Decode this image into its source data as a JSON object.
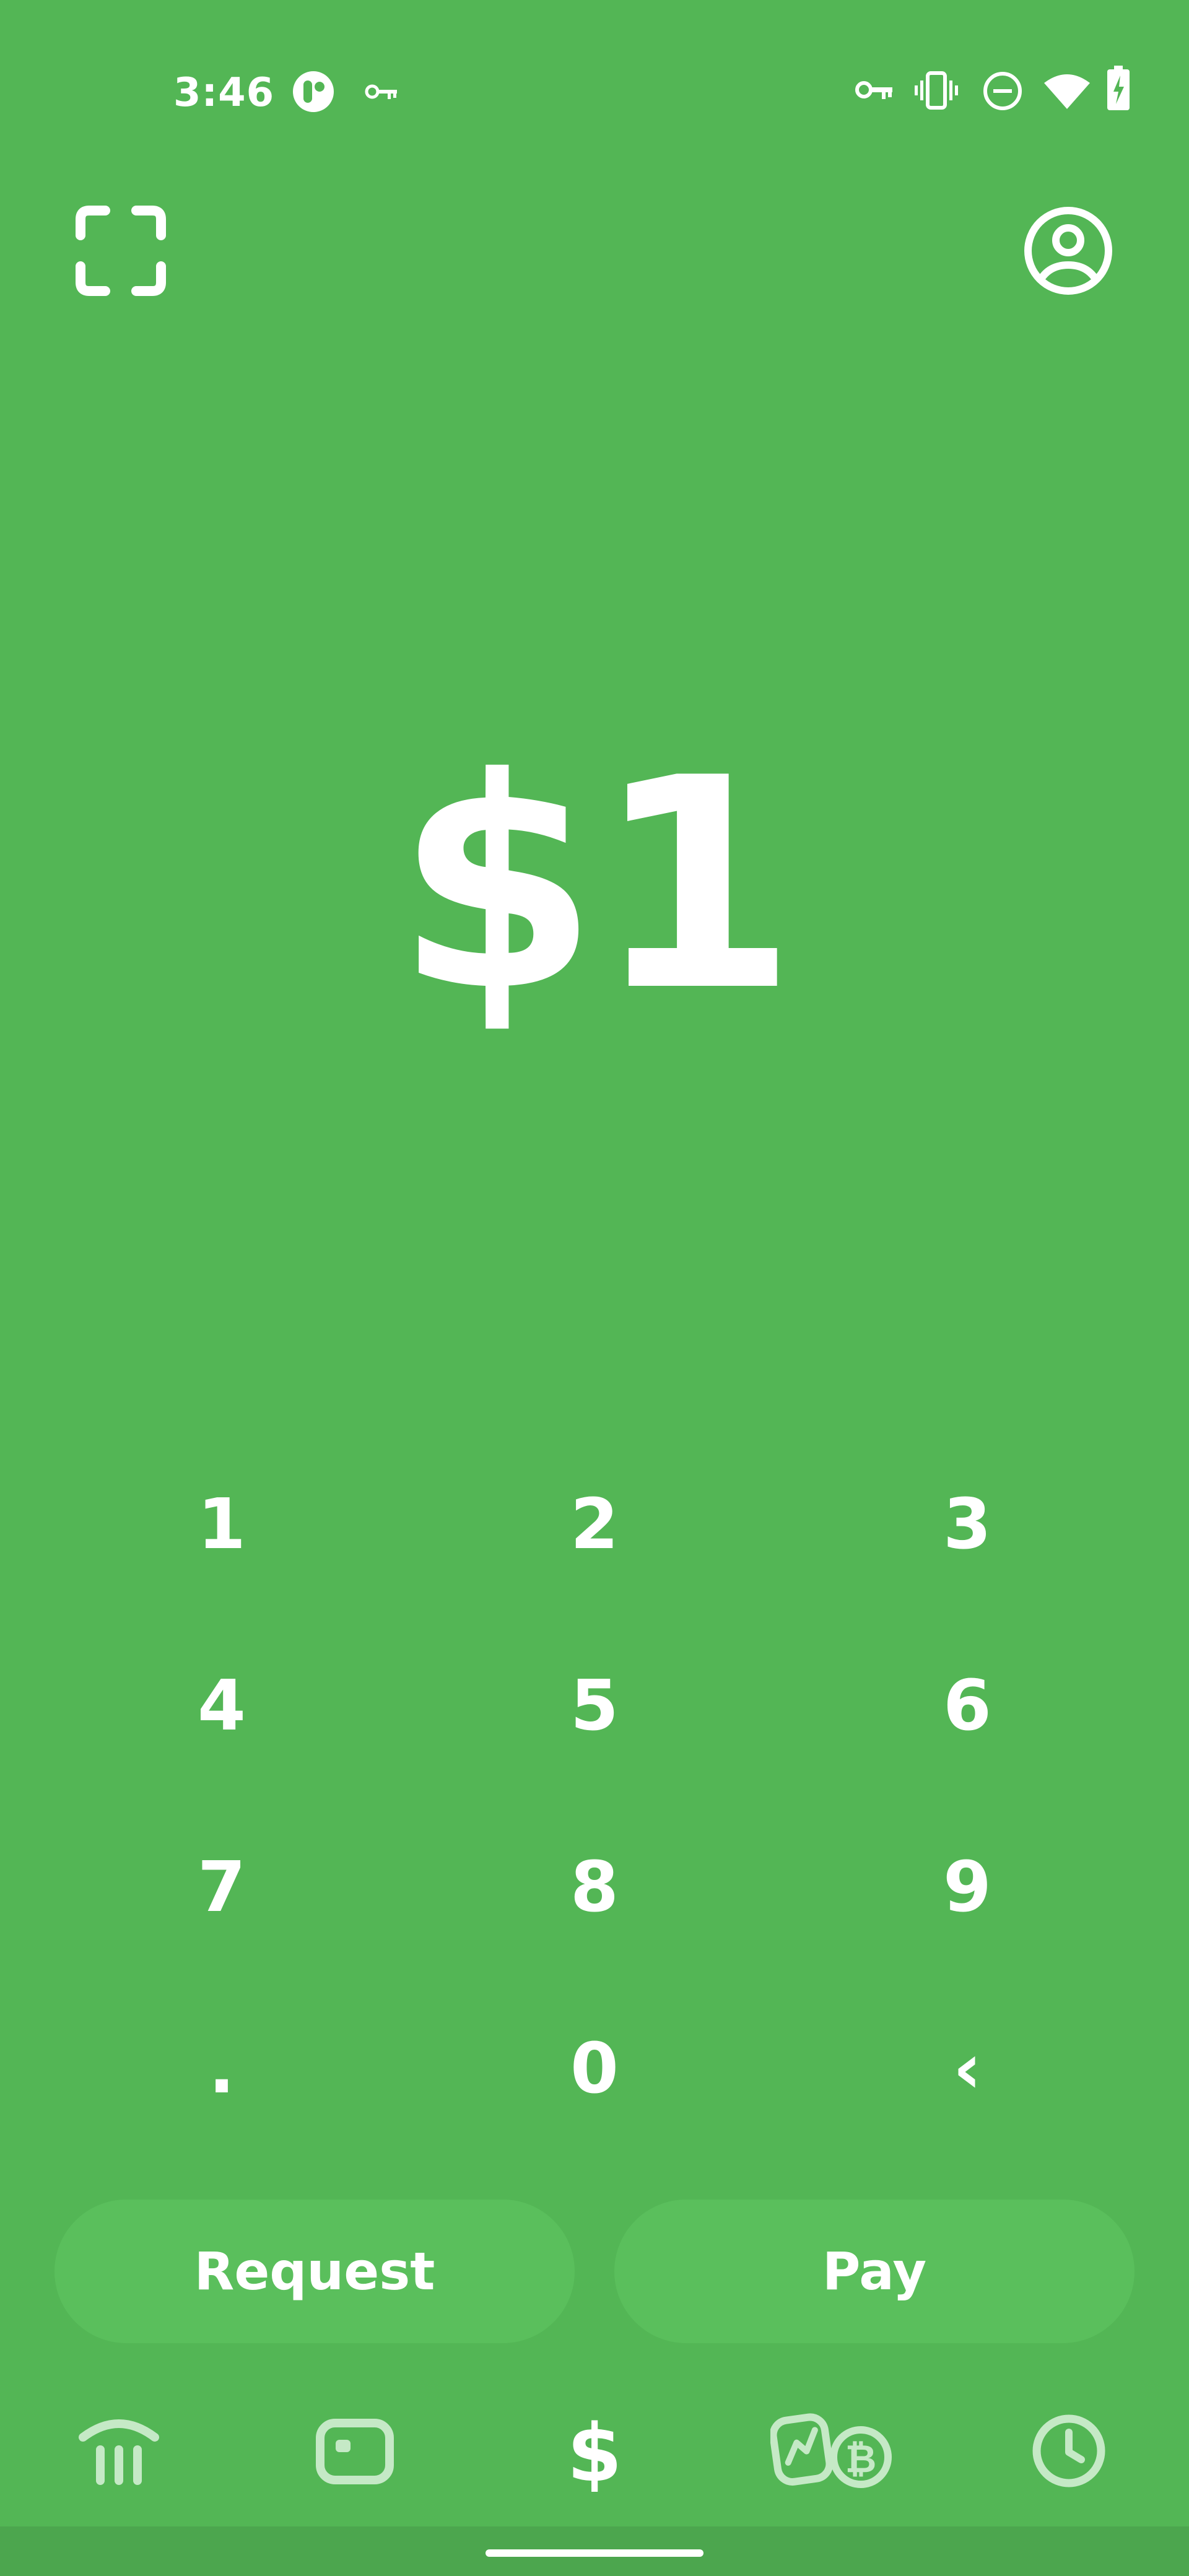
{
  "status_bar": {
    "time": "3:46",
    "left_icons": [
      "app-notification-icon",
      "vpn-key-icon"
    ],
    "right_icons": [
      "vpn-key-icon",
      "vibrate-icon",
      "do-not-disturb-icon",
      "wifi-icon",
      "battery-charging-icon"
    ]
  },
  "top_bar": {
    "left_icon": "qr-scan-icon",
    "right_icon": "profile-icon"
  },
  "amount": {
    "display": "$1"
  },
  "keypad": {
    "keys": [
      "1",
      "2",
      "3",
      "4",
      "5",
      "6",
      "7",
      "8",
      "9",
      ".",
      "0",
      "‹"
    ]
  },
  "actions": {
    "request_label": "Request",
    "pay_label": "Pay"
  },
  "bottom_nav": {
    "tabs": [
      "home-icon",
      "card-icon",
      "dollar-icon",
      "investing-bitcoin-icon",
      "activity-clock-icon"
    ],
    "active_tab": "dollar-icon"
  },
  "theme": {
    "background": "#53B655",
    "button_fill": "#5ABF5C",
    "foreground": "#FFFFFF",
    "inactive_icon": "#C5E9C6"
  }
}
